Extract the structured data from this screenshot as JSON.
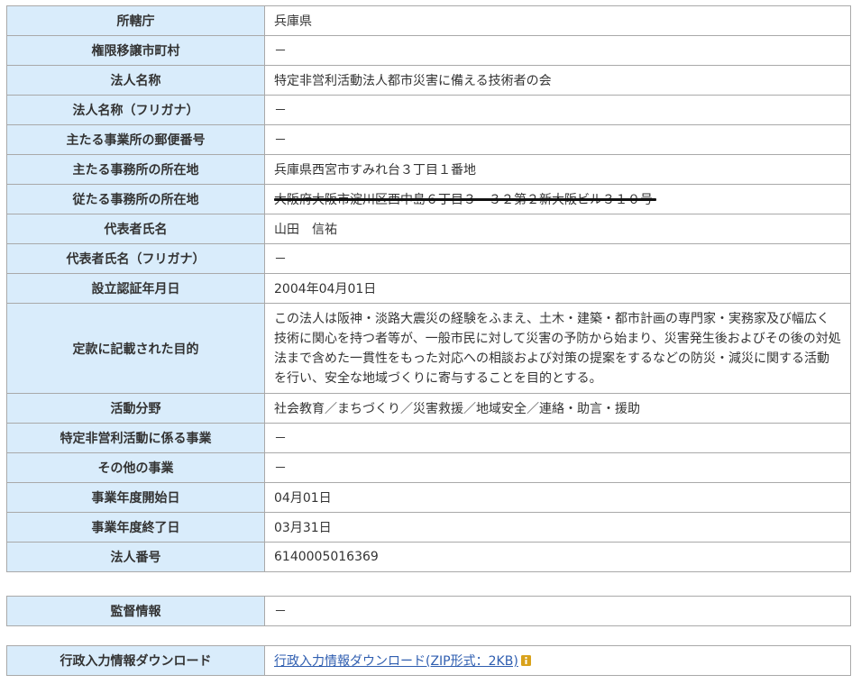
{
  "main_table": {
    "rows": [
      {
        "label": "所轄庁",
        "value": "兵庫県"
      },
      {
        "label": "権限移譲市町村",
        "value": "－"
      },
      {
        "label": "法人名称",
        "value": "特定非営利活動法人都市災害に備える技術者の会"
      },
      {
        "label": "法人名称（フリガナ）",
        "value": "－"
      },
      {
        "label": "主たる事業所の郵便番号",
        "value": "－"
      },
      {
        "label": "主たる事務所の所在地",
        "value": "兵庫県西宮市すみれ台３丁目１番地"
      },
      {
        "label": "従たる事務所の所在地",
        "value": "大阪府大阪市淀川区西中島６丁目３－３２第２新大阪ビル３１０号"
      },
      {
        "label": "代表者氏名",
        "value": "山田　信祐"
      },
      {
        "label": "代表者氏名（フリガナ）",
        "value": "－"
      },
      {
        "label": "設立認証年月日",
        "value": "2004年04月01日"
      },
      {
        "label": "定款に記載された目的",
        "value": "この法人は阪神・淡路大震災の経験をふまえ、土木・建築・都市計画の専門家・実務家及び幅広く技術に関心を持つ者等が、一般市民に対して災害の予防から始まり、災害発生後およびその後の対処法まで含めた一貫性をもった対応への相談および対策の提案をするなどの防災・減災に関する活動を行い、安全な地域づくりに寄与することを目的とする。"
      },
      {
        "label": "活動分野",
        "value": "社会教育／まちづくり／災害救援／地域安全／連絡・助言・援助"
      },
      {
        "label": "特定非営利活動に係る事業",
        "value": "－"
      },
      {
        "label": "その他の事業",
        "value": "－"
      },
      {
        "label": "事業年度開始日",
        "value": "04月01日"
      },
      {
        "label": "事業年度終了日",
        "value": "03月31日"
      },
      {
        "label": "法人番号",
        "value": "6140005016369"
      }
    ]
  },
  "supervision": {
    "label": "監督情報",
    "value": "－"
  },
  "download": {
    "label": "行政入力情報ダウンロード",
    "link_text": "行政入力情報ダウンロード(ZIP形式：2KB)"
  },
  "colors": {
    "header_bg": "#d9ecfb",
    "border": "#a9a9a9",
    "link": "#2f5eb0",
    "icon": "#d9a21b"
  },
  "icons": {
    "download_info": "info-icon"
  }
}
